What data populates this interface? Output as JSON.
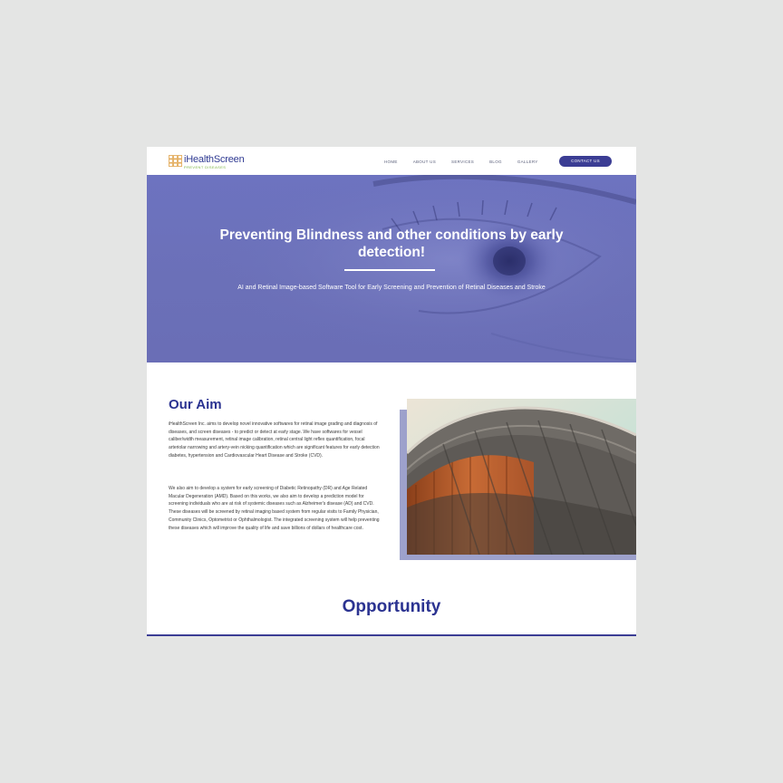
{
  "brand": {
    "name": "iHealthScreen",
    "tagline": "PREVENT DISEASES",
    "accent": "#3b3d94",
    "tagline_color": "#7cb342"
  },
  "nav": {
    "links": [
      "HOME",
      "ABOUT US",
      "SERVICES",
      "BLOG",
      "GALLERY"
    ],
    "cta": "CONTACT US"
  },
  "hero": {
    "title": "Preventing Blindness and other conditions by early detection!",
    "subtitle": "AI and Retinal Image-based Software Tool for Early Screening and Prevention of Retinal Diseases and Stroke",
    "background": "#6c71bb"
  },
  "aim": {
    "title": "Our Aim",
    "paragraph1": "iHealthScreen Inc. aims to develop novel innovative softwares for retinal image grading and diagnosis of diseases, and screen diseases - to predict or detect at early stage. We have softwares for vessel caliber/width measurement, retinal image calibration, retinal central light reflex quantification, focal arteriolar narrowing and artery-vein nicking quantification which are significant features for early detection diabetes, hypertension and Cardiovascular Heart Disease and Stroke (CVD).",
    "paragraph2": "We also aim to develop a system for early screening of Diabetic Retinopathy (DR) and Age Related Macular Degeneration (AMD). Based on this works, we also aim to develop a prediction model for screening individuals who are at risk of systemic diseases such as Alzheimer's disease (AD) and CVD. These diseases will be screened by retinal imaging based system from regular visits to Family Physician, Community Clinics, Optometrist or Ophthalmologist. The integrated screening system will help preventing these diseases which will improve the quality of life and save billions of dollars of healthcare cost."
  },
  "opportunity": {
    "title": "Opportunity"
  }
}
